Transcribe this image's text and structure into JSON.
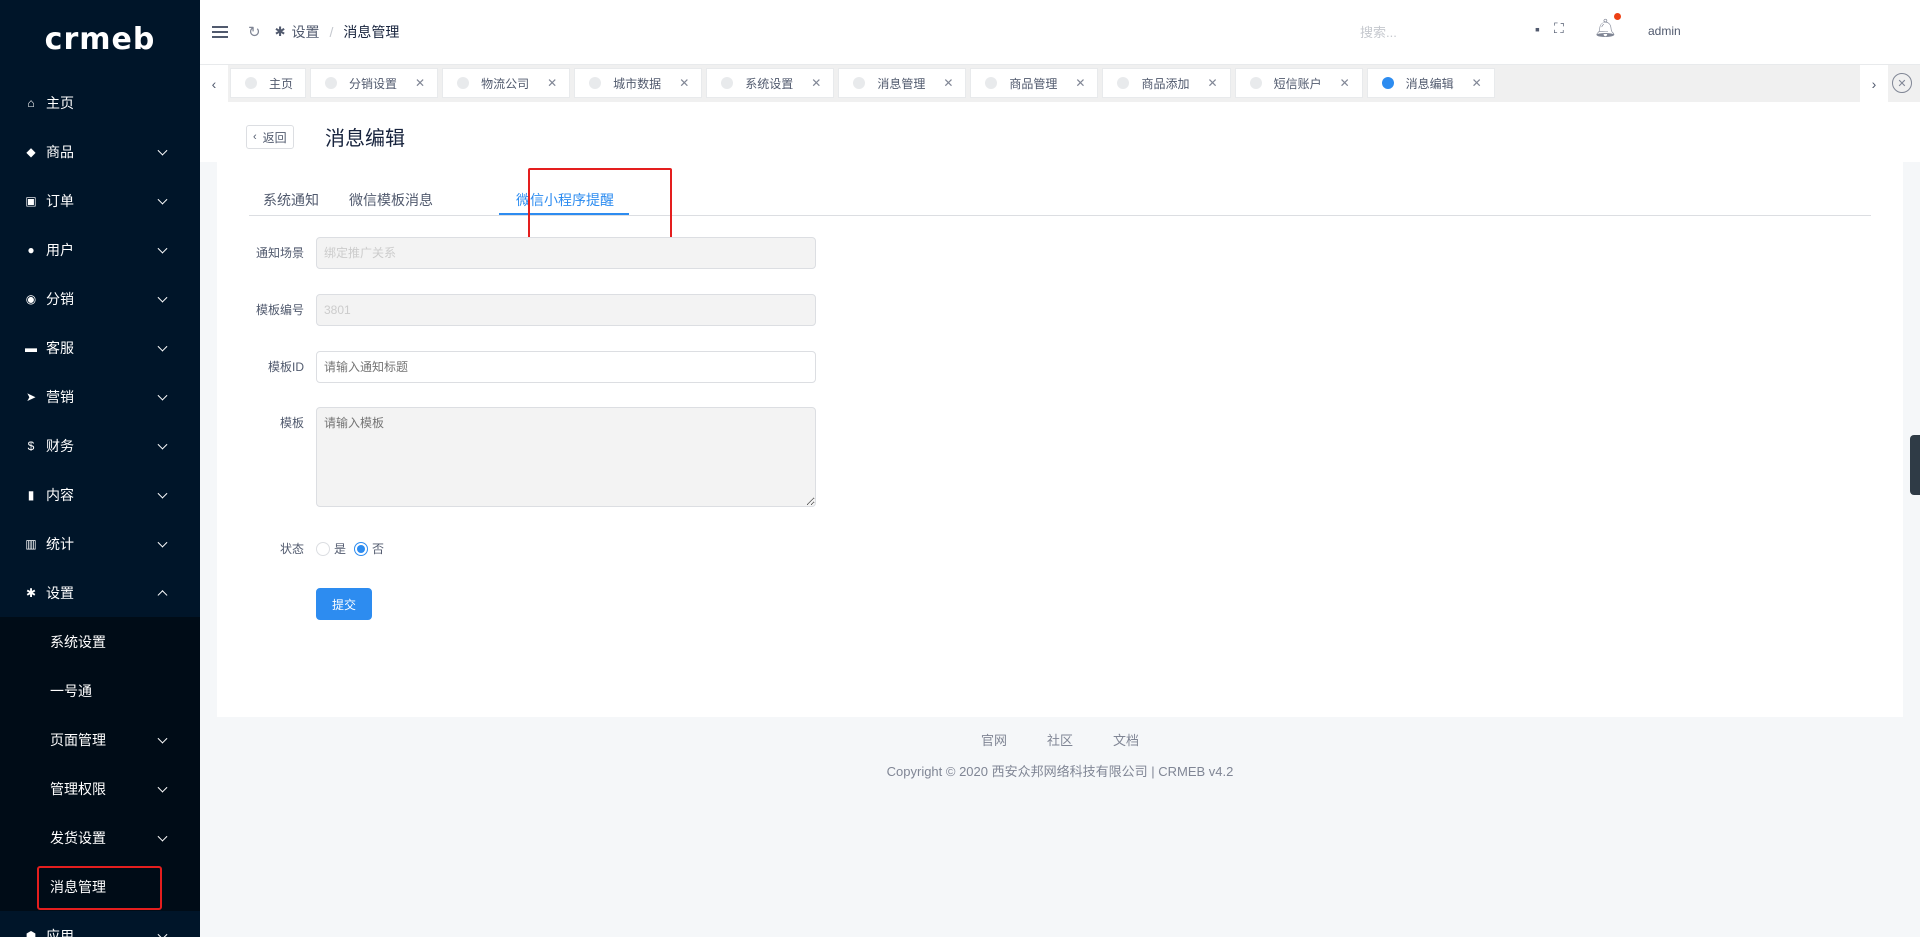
{
  "logo": "crmeb",
  "sidebar": {
    "items": [
      {
        "label": "主页",
        "icon": "home-icon",
        "glyph": "⌂",
        "chevron": ""
      },
      {
        "label": "商品",
        "icon": "goods-icon",
        "glyph": "◆",
        "chevron": "down"
      },
      {
        "label": "订单",
        "icon": "cart-icon",
        "glyph": "▣",
        "chevron": "down"
      },
      {
        "label": "用户",
        "icon": "user-icon",
        "glyph": "●",
        "chevron": "down"
      },
      {
        "label": "分销",
        "icon": "share-icon",
        "glyph": "◉",
        "chevron": "down"
      },
      {
        "label": "客服",
        "icon": "chat-icon",
        "glyph": "▬",
        "chevron": "down"
      },
      {
        "label": "营销",
        "icon": "send-icon",
        "glyph": "➤",
        "chevron": "down"
      },
      {
        "label": "财务",
        "icon": "dollar-icon",
        "glyph": "$",
        "chevron": "down"
      },
      {
        "label": "内容",
        "icon": "book-icon",
        "glyph": "▮",
        "chevron": "down"
      },
      {
        "label": "统计",
        "icon": "chart-icon",
        "glyph": "▥",
        "chevron": "down"
      },
      {
        "label": "设置",
        "icon": "gear-icon",
        "glyph": "✱",
        "chevron": "up"
      }
    ],
    "sub_items": [
      {
        "label": "系统设置",
        "chevron": false
      },
      {
        "label": "一号通",
        "chevron": false
      },
      {
        "label": "页面管理",
        "chevron": true
      },
      {
        "label": "管理权限",
        "chevron": true
      },
      {
        "label": "发货设置",
        "chevron": true
      },
      {
        "label": "消息管理",
        "chevron": false
      }
    ],
    "after_items": [
      {
        "label": "应用",
        "icon": "cube-icon",
        "glyph": "⬢",
        "chevron": "down"
      }
    ]
  },
  "header": {
    "breadcrumb_parent": "设置",
    "breadcrumb_sep": "/",
    "breadcrumb_current": "消息管理",
    "search_placeholder": "搜索...",
    "user_name": "admin"
  },
  "tabs": [
    {
      "label": "主页",
      "closable": false,
      "active": false
    },
    {
      "label": "分销设置",
      "closable": true,
      "active": false
    },
    {
      "label": "物流公司",
      "closable": true,
      "active": false
    },
    {
      "label": "城市数据",
      "closable": true,
      "active": false
    },
    {
      "label": "系统设置",
      "closable": true,
      "active": false
    },
    {
      "label": "消息管理",
      "closable": true,
      "active": false
    },
    {
      "label": "商品管理",
      "closable": true,
      "active": false
    },
    {
      "label": "商品添加",
      "closable": true,
      "active": false
    },
    {
      "label": "短信账户",
      "closable": true,
      "active": false
    },
    {
      "label": "消息编辑",
      "closable": true,
      "active": true
    }
  ],
  "page": {
    "back_label": "返回",
    "title": "消息编辑"
  },
  "content_tabs": {
    "system": "系统通知",
    "wechat_template": "微信模板消息",
    "mini_program": "微信小程序提醒"
  },
  "form": {
    "scene_label": "通知场景",
    "scene_value": "绑定推广关系",
    "template_no_label": "模板编号",
    "template_no_value": "3801",
    "template_id_label": "模板ID",
    "template_id_placeholder": "请输入通知标题",
    "template_label": "模板",
    "template_placeholder": "请输入模板",
    "status_label": "状态",
    "status_yes": "是",
    "status_no": "否",
    "status_value": "否",
    "submit_label": "提交"
  },
  "footer": {
    "links": [
      "官网",
      "社区",
      "文档"
    ],
    "copyright": "Copyright © 2020 西安众邦网络科技有限公司 | CRMEB v4.2"
  },
  "colors": {
    "sidebar_bg": "#001529",
    "accent": "#2d8cf0",
    "highlight": "#e41e1e"
  }
}
